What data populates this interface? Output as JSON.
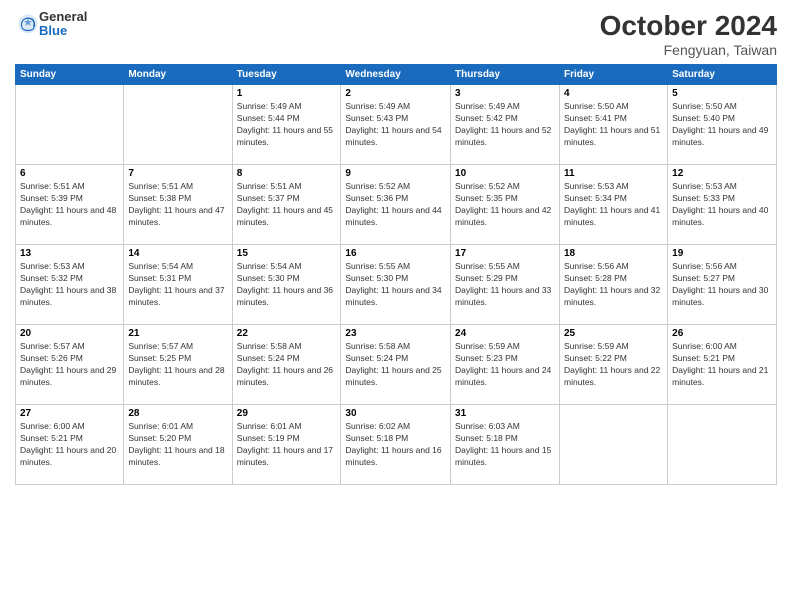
{
  "logo": {
    "general": "General",
    "blue": "Blue"
  },
  "header": {
    "month": "October 2024",
    "location": "Fengyuan, Taiwan"
  },
  "weekdays": [
    "Sunday",
    "Monday",
    "Tuesday",
    "Wednesday",
    "Thursday",
    "Friday",
    "Saturday"
  ],
  "weeks": [
    [
      {
        "day": "",
        "sunrise": "",
        "sunset": "",
        "daylight": ""
      },
      {
        "day": "",
        "sunrise": "",
        "sunset": "",
        "daylight": ""
      },
      {
        "day": "1",
        "sunrise": "Sunrise: 5:49 AM",
        "sunset": "Sunset: 5:44 PM",
        "daylight": "Daylight: 11 hours and 55 minutes."
      },
      {
        "day": "2",
        "sunrise": "Sunrise: 5:49 AM",
        "sunset": "Sunset: 5:43 PM",
        "daylight": "Daylight: 11 hours and 54 minutes."
      },
      {
        "day": "3",
        "sunrise": "Sunrise: 5:49 AM",
        "sunset": "Sunset: 5:42 PM",
        "daylight": "Daylight: 11 hours and 52 minutes."
      },
      {
        "day": "4",
        "sunrise": "Sunrise: 5:50 AM",
        "sunset": "Sunset: 5:41 PM",
        "daylight": "Daylight: 11 hours and 51 minutes."
      },
      {
        "day": "5",
        "sunrise": "Sunrise: 5:50 AM",
        "sunset": "Sunset: 5:40 PM",
        "daylight": "Daylight: 11 hours and 49 minutes."
      }
    ],
    [
      {
        "day": "6",
        "sunrise": "Sunrise: 5:51 AM",
        "sunset": "Sunset: 5:39 PM",
        "daylight": "Daylight: 11 hours and 48 minutes."
      },
      {
        "day": "7",
        "sunrise": "Sunrise: 5:51 AM",
        "sunset": "Sunset: 5:38 PM",
        "daylight": "Daylight: 11 hours and 47 minutes."
      },
      {
        "day": "8",
        "sunrise": "Sunrise: 5:51 AM",
        "sunset": "Sunset: 5:37 PM",
        "daylight": "Daylight: 11 hours and 45 minutes."
      },
      {
        "day": "9",
        "sunrise": "Sunrise: 5:52 AM",
        "sunset": "Sunset: 5:36 PM",
        "daylight": "Daylight: 11 hours and 44 minutes."
      },
      {
        "day": "10",
        "sunrise": "Sunrise: 5:52 AM",
        "sunset": "Sunset: 5:35 PM",
        "daylight": "Daylight: 11 hours and 42 minutes."
      },
      {
        "day": "11",
        "sunrise": "Sunrise: 5:53 AM",
        "sunset": "Sunset: 5:34 PM",
        "daylight": "Daylight: 11 hours and 41 minutes."
      },
      {
        "day": "12",
        "sunrise": "Sunrise: 5:53 AM",
        "sunset": "Sunset: 5:33 PM",
        "daylight": "Daylight: 11 hours and 40 minutes."
      }
    ],
    [
      {
        "day": "13",
        "sunrise": "Sunrise: 5:53 AM",
        "sunset": "Sunset: 5:32 PM",
        "daylight": "Daylight: 11 hours and 38 minutes."
      },
      {
        "day": "14",
        "sunrise": "Sunrise: 5:54 AM",
        "sunset": "Sunset: 5:31 PM",
        "daylight": "Daylight: 11 hours and 37 minutes."
      },
      {
        "day": "15",
        "sunrise": "Sunrise: 5:54 AM",
        "sunset": "Sunset: 5:30 PM",
        "daylight": "Daylight: 11 hours and 36 minutes."
      },
      {
        "day": "16",
        "sunrise": "Sunrise: 5:55 AM",
        "sunset": "Sunset: 5:30 PM",
        "daylight": "Daylight: 11 hours and 34 minutes."
      },
      {
        "day": "17",
        "sunrise": "Sunrise: 5:55 AM",
        "sunset": "Sunset: 5:29 PM",
        "daylight": "Daylight: 11 hours and 33 minutes."
      },
      {
        "day": "18",
        "sunrise": "Sunrise: 5:56 AM",
        "sunset": "Sunset: 5:28 PM",
        "daylight": "Daylight: 11 hours and 32 minutes."
      },
      {
        "day": "19",
        "sunrise": "Sunrise: 5:56 AM",
        "sunset": "Sunset: 5:27 PM",
        "daylight": "Daylight: 11 hours and 30 minutes."
      }
    ],
    [
      {
        "day": "20",
        "sunrise": "Sunrise: 5:57 AM",
        "sunset": "Sunset: 5:26 PM",
        "daylight": "Daylight: 11 hours and 29 minutes."
      },
      {
        "day": "21",
        "sunrise": "Sunrise: 5:57 AM",
        "sunset": "Sunset: 5:25 PM",
        "daylight": "Daylight: 11 hours and 28 minutes."
      },
      {
        "day": "22",
        "sunrise": "Sunrise: 5:58 AM",
        "sunset": "Sunset: 5:24 PM",
        "daylight": "Daylight: 11 hours and 26 minutes."
      },
      {
        "day": "23",
        "sunrise": "Sunrise: 5:58 AM",
        "sunset": "Sunset: 5:24 PM",
        "daylight": "Daylight: 11 hours and 25 minutes."
      },
      {
        "day": "24",
        "sunrise": "Sunrise: 5:59 AM",
        "sunset": "Sunset: 5:23 PM",
        "daylight": "Daylight: 11 hours and 24 minutes."
      },
      {
        "day": "25",
        "sunrise": "Sunrise: 5:59 AM",
        "sunset": "Sunset: 5:22 PM",
        "daylight": "Daylight: 11 hours and 22 minutes."
      },
      {
        "day": "26",
        "sunrise": "Sunrise: 6:00 AM",
        "sunset": "Sunset: 5:21 PM",
        "daylight": "Daylight: 11 hours and 21 minutes."
      }
    ],
    [
      {
        "day": "27",
        "sunrise": "Sunrise: 6:00 AM",
        "sunset": "Sunset: 5:21 PM",
        "daylight": "Daylight: 11 hours and 20 minutes."
      },
      {
        "day": "28",
        "sunrise": "Sunrise: 6:01 AM",
        "sunset": "Sunset: 5:20 PM",
        "daylight": "Daylight: 11 hours and 18 minutes."
      },
      {
        "day": "29",
        "sunrise": "Sunrise: 6:01 AM",
        "sunset": "Sunset: 5:19 PM",
        "daylight": "Daylight: 11 hours and 17 minutes."
      },
      {
        "day": "30",
        "sunrise": "Sunrise: 6:02 AM",
        "sunset": "Sunset: 5:18 PM",
        "daylight": "Daylight: 11 hours and 16 minutes."
      },
      {
        "day": "31",
        "sunrise": "Sunrise: 6:03 AM",
        "sunset": "Sunset: 5:18 PM",
        "daylight": "Daylight: 11 hours and 15 minutes."
      },
      {
        "day": "",
        "sunrise": "",
        "sunset": "",
        "daylight": ""
      },
      {
        "day": "",
        "sunrise": "",
        "sunset": "",
        "daylight": ""
      }
    ]
  ]
}
